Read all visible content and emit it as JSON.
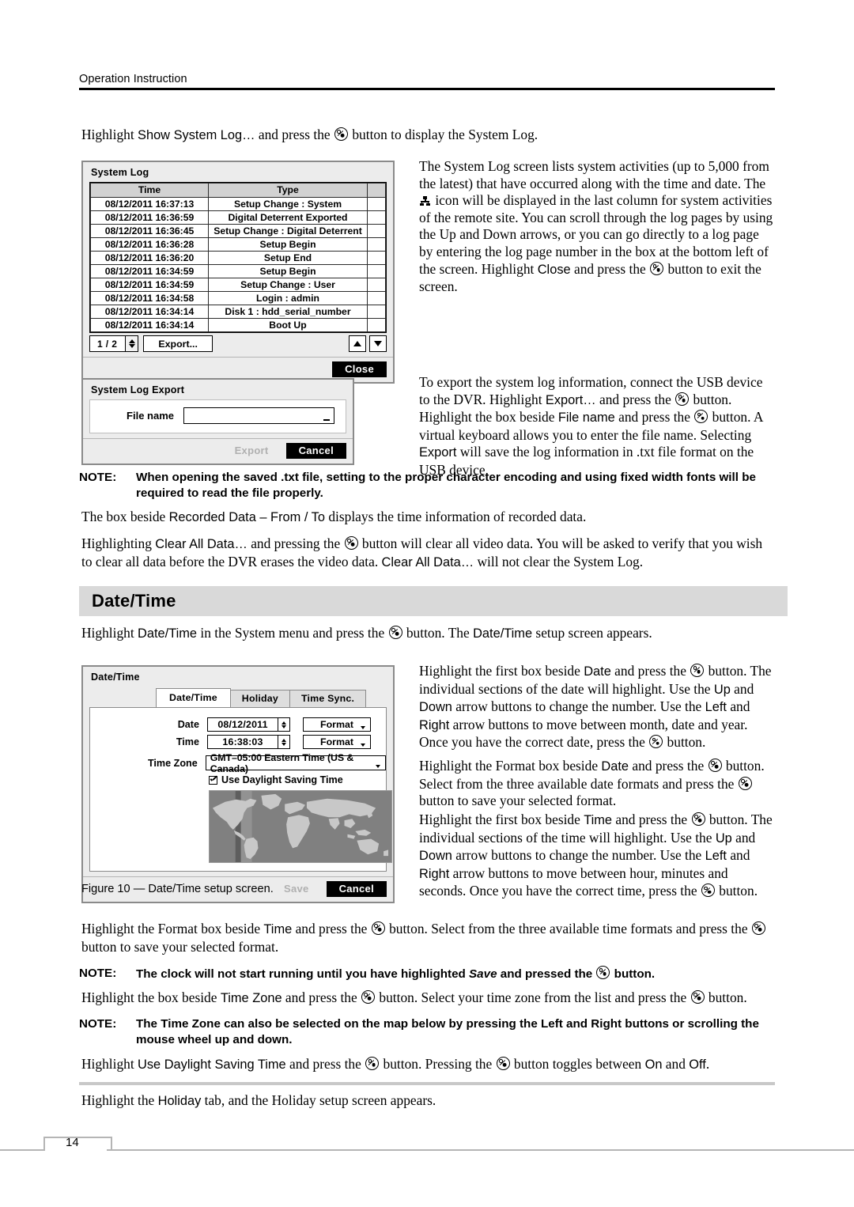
{
  "header": {
    "running_head": "Operation Instruction"
  },
  "intro": {
    "line_pre": "Highlight ",
    "line_ui": "Show System Log…",
    "line_mid": " and press the ",
    "line_post": " button to display the System Log."
  },
  "system_log_dialog": {
    "title": "System Log",
    "columns": [
      "Time",
      "Type",
      ""
    ],
    "rows": [
      {
        "time": "08/12/2011  16:37:13",
        "type": "Setup Change : System"
      },
      {
        "time": "08/12/2011  16:36:59",
        "type": "Digital Deterrent Exported"
      },
      {
        "time": "08/12/2011  16:36:45",
        "type": "Setup Change : Digital Deterrent"
      },
      {
        "time": "08/12/2011  16:36:28",
        "type": "Setup Begin"
      },
      {
        "time": "08/12/2011  16:36:20",
        "type": "Setup End"
      },
      {
        "time": "08/12/2011  16:34:59",
        "type": "Setup Begin"
      },
      {
        "time": "08/12/2011  16:34:59",
        "type": "Setup Change : User"
      },
      {
        "time": "08/12/2011  16:34:58",
        "type": "Login : admin"
      },
      {
        "time": "08/12/2011  16:34:14",
        "type": "Disk 1 : hdd_serial_number"
      },
      {
        "time": "08/12/2011  16:34:14",
        "type": "Boot Up"
      }
    ],
    "page_indicator": "1 / 2",
    "export_button": "Export...",
    "close_button": "Close"
  },
  "log_paragraph": {
    "p1": "The System Log screen lists system activities (up to 5,000 from the latest) that have occurred along with the time and date.  The ",
    "p2": " icon will be displayed in the last column for system activities of the remote site.  You can scroll through the log pages by using the Up and Down arrows, or you can go directly to a log page by entering the log page number in the box at the bottom left of the screen.  Highlight ",
    "p2_ui": "Close",
    "p3": " and press the ",
    "p4": " button to exit the screen."
  },
  "export_dialog": {
    "title": "System Log Export",
    "file_name_label": "File name",
    "file_name_value": "",
    "export_button": "Export",
    "cancel_button": "Cancel"
  },
  "export_paragraph": {
    "a": "To export the system log information, connect the USB device to the DVR.  Highlight ",
    "a_ui": "Export…",
    "b": " and press the ",
    "c": " button.  Highlight the box beside ",
    "c_ui": "File name",
    "d": " and press the ",
    "e": " button.  A virtual keyboard allows you to enter the file name.  Selecting ",
    "e_ui": "Export",
    "f": " will save the log information in .txt file format on the USB device."
  },
  "note_1": {
    "label": "NOTE:",
    "text": "When opening the saved .txt file, setting to the proper character encoding and using fixed width fonts will be required to read the file properly."
  },
  "recorded_data_paragraph": {
    "a": "The box beside ",
    "a_ui": "Recorded Data – From / To",
    "b": " displays the time information of recorded data."
  },
  "clear_all_paragraph": {
    "a": "Highlighting ",
    "a_ui": "Clear All Data…",
    "b": " and pressing the ",
    "c": " button will clear all video data.  You will be asked to verify that you wish to clear all data before the DVR erases the video data.  ",
    "c_ui": "Clear All Data…",
    "d": " will not clear the System Log."
  },
  "section": {
    "heading": "Date/Time"
  },
  "datetime_intro": {
    "a": "Highlight ",
    "a_ui": "Date/Time",
    "b": " in the System menu and press the ",
    "c": " button.  The ",
    "c_ui": "Date/Time",
    "d": " setup screen appears."
  },
  "datetime_dialog": {
    "title": "Date/Time",
    "tabs": [
      {
        "label": "Date/Time",
        "active": true
      },
      {
        "label": "Holiday",
        "active": false
      },
      {
        "label": "Time Sync.",
        "active": false
      }
    ],
    "date_label": "Date",
    "date_value": "08/12/2011",
    "date_format_button": "Format",
    "time_label": "Time",
    "time_value": "16:38:03",
    "time_format_button": "Format",
    "timezone_label": "Time Zone",
    "timezone_value": "GMT–05:00   Eastern Time (US & Canada)",
    "dst_label": "Use Daylight Saving Time",
    "dst_checked": true,
    "save_button": "Save",
    "cancel_button": "Cancel"
  },
  "figure_caption": "Figure 10 — Date/Time setup screen.",
  "date_paragraph": {
    "a": "Highlight the first box beside ",
    "a_ui": "Date",
    "b": " and press the ",
    "c": " button.  The individual sections of the date will highlight.  Use the ",
    "c_ui": "Up",
    "d": " and ",
    "d_ui": "Down",
    "e": " arrow buttons to change the number.  Use the ",
    "e_ui": "Left",
    "f": " and ",
    "f_ui": "Right",
    "g": " arrow buttons to move between month, date and year.  Once you have the correct date, press the ",
    "h": " button."
  },
  "date_format_paragraph": {
    "a": "Highlight the Format box beside ",
    "a_ui": "Date",
    "b": " and press the ",
    "c": " button.  Select from the three available date formats and press the ",
    "d": " button to save your selected format."
  },
  "time_paragraph": {
    "a": "Highlight the first box beside ",
    "a_ui": "Time",
    "b": " and press the ",
    "c": " button.  The individual sections of the time will highlight.  Use the ",
    "c_ui": "Up",
    "d": " and ",
    "d_ui": "Down",
    "e": " arrow buttons to change the number.  Use the ",
    "e_ui": "Left",
    "f": " and ",
    "f_ui": "Right",
    "g": " arrow buttons to move between hour, minutes and seconds.  Once you have the correct time, press the ",
    "h": " button."
  },
  "time_format_paragraph": {
    "a": "Highlight the Format box beside ",
    "a_ui": "Time",
    "b": " and press the ",
    "c": " button.  Select from the three available time formats and press the ",
    "d": " button to save your selected format."
  },
  "note_2": {
    "label": "NOTE:",
    "text_before": "The clock will not start running until you have highlighted ",
    "text_italic": "Save",
    "text_mid": " and pressed the ",
    "text_after": " button."
  },
  "timezone_paragraph": {
    "a": "Highlight the box beside ",
    "a_ui": "Time Zone",
    "b": " and press the ",
    "c": " button.  Select your time zone from the list and press the ",
    "d": " button."
  },
  "note_3": {
    "label": "NOTE:",
    "text": "The Time Zone can also be selected on the map below by pressing the Left and Right buttons or scrolling the mouse wheel up and down."
  },
  "dst_paragraph": {
    "a": "Highlight ",
    "a_ui": "Use Daylight Saving Time",
    "b": " and press the ",
    "c": " button.  Pressing the ",
    "d": " button toggles between ",
    "d_ui": "On",
    "e": " and ",
    "e_ui": "Off",
    "f": "."
  },
  "holiday_paragraph": {
    "a": "Highlight the ",
    "a_ui": "Holiday",
    "b": " tab, and the Holiday setup screen appears."
  },
  "footer": {
    "page_number": "14"
  },
  "colors": {
    "section_band": "#d9d9d9",
    "dialog_face": "#ececec",
    "table_header": "#d2d2d2",
    "map_ocean": "#808080",
    "map_land": "#c8c8c8",
    "highlight_button": "#000000"
  }
}
